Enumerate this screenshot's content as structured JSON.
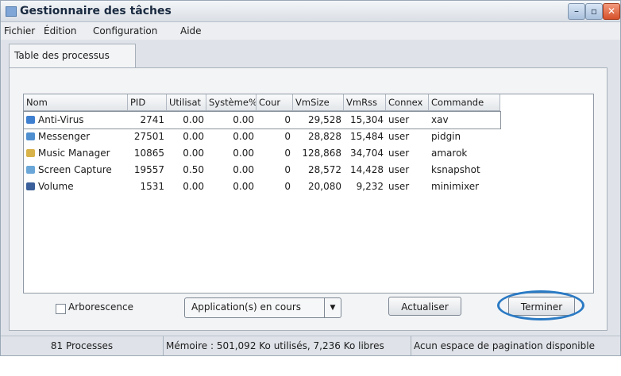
{
  "window": {
    "title": "Gestionnaire des tâches",
    "min": "–",
    "max": "▫",
    "close": "✕"
  },
  "menu": [
    "Fichier",
    "Édition",
    "Configuration",
    "Aide"
  ],
  "tab": "Table des processus",
  "table": {
    "columns": [
      "Nom",
      "PID",
      "Utilisat",
      "Système%",
      "Cour",
      "VmSize",
      "VmRss",
      "Connex",
      "Commande"
    ],
    "rows": [
      [
        "Anti-Virus",
        "2741",
        "0.00",
        "0.00",
        "0",
        "29,528",
        "15,304",
        "user",
        "xav"
      ],
      [
        "Messenger",
        "27501",
        "0.00",
        "0.00",
        "0",
        "28,828",
        "15,484",
        "user",
        "pidgin"
      ],
      [
        "Music Manager",
        "10865",
        "0.00",
        "0.00",
        "0",
        "128,868",
        "34,704",
        "user",
        "amarok"
      ],
      [
        "Screen Capture",
        "19557",
        "0.50",
        "0.00",
        "0",
        "28,572",
        "14,428",
        "user",
        "ksnapshot"
      ],
      [
        "Volume",
        "1531",
        "0.00",
        "0.00",
        "0",
        "20,080",
        "9,232",
        "user",
        "minimixer"
      ]
    ],
    "row_icon_colors": [
      "#3e7fd0",
      "#4f8fcf",
      "#d8b34a",
      "#6aa7d8",
      "#3a5f9a"
    ]
  },
  "controls": {
    "tree_label": "Arborescence",
    "filter_value": "Application(s) en cours",
    "refresh_label": "Actualiser",
    "kill_label": "Terminer"
  },
  "status": {
    "processes": "81 Processes",
    "memory": "Mémoire : 501,092 Ko utilisés, 7,236 Ko libres",
    "swap": "Acun espace de pagination disponible"
  },
  "colors": {
    "highlight": "#2a7ac4"
  }
}
